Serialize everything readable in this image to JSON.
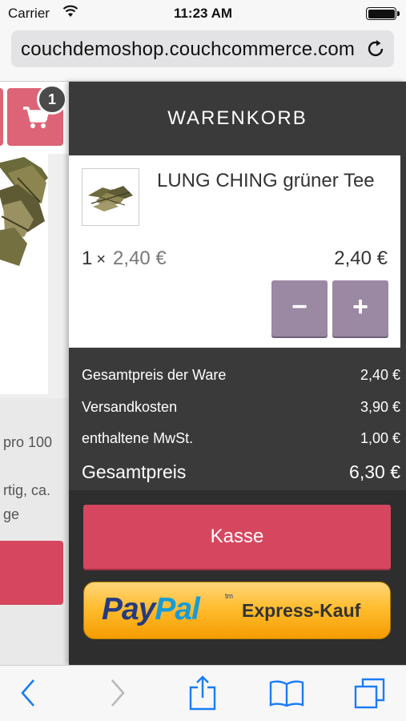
{
  "status_bar": {
    "carrier": "Carrier",
    "time": "11:23 AM"
  },
  "browser": {
    "url": "couchdemoshop.couchcommerce.com"
  },
  "left_page": {
    "cart_badge_count": "1",
    "text_lines": [
      "pro 100",
      "rtig, ca.",
      "ge"
    ]
  },
  "cart": {
    "title": "WARENKORB",
    "item": {
      "name": "LUNG CHING grüner Tee",
      "quantity": "1",
      "times_sign": "×",
      "unit_price": "2,40 €",
      "total": "2,40 €",
      "minus_label": "−",
      "plus_label": "+"
    },
    "summary": [
      {
        "label": "Gesamtpreis der Ware",
        "value": "2,40 €"
      },
      {
        "label": "Versandkosten",
        "value": "3,90 €"
      },
      {
        "label": "enthaltene MwSt.",
        "value": "1,00 €"
      }
    ],
    "grand_total": {
      "label": "Gesamtpreis",
      "value": "6,30 €"
    },
    "checkout_label": "Kasse",
    "paypal": {
      "logo_part1": "Pay",
      "logo_part2": "Pal",
      "tm": "tm",
      "label": "Express-Kauf"
    }
  },
  "colors": {
    "accent": "#d6475f",
    "qty_button": "#9b88a3",
    "panel": "#3a3a3a",
    "ios_blue": "#1a7cf5"
  }
}
